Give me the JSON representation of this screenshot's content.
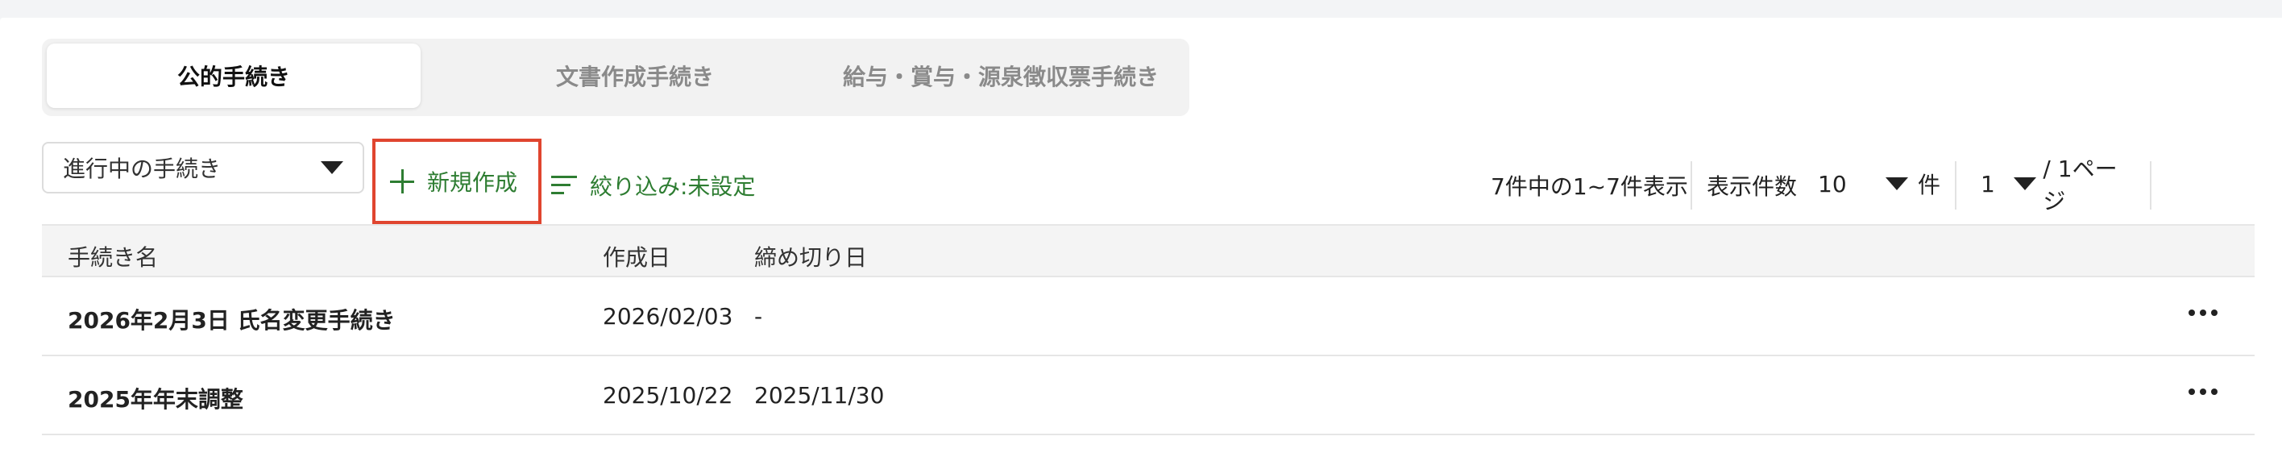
{
  "tabs": [
    "公的手続き",
    "文書作成手続き",
    "給与・賞与・源泉徴収票手続き"
  ],
  "toolbar": {
    "status_select": "進行中の手続き",
    "new_button": "新規作成",
    "filter": "絞り込み:未設定",
    "count_text": "7件中の1~7件表示",
    "per_page_label": "表示件数",
    "per_page_value": "10",
    "per_page_unit": "件",
    "page_value": "1",
    "page_unit": "/ 1ページ"
  },
  "table": {
    "headers": [
      "手続き名",
      "作成日",
      "締め切り日"
    ],
    "rows": [
      {
        "name": "2026年2月3日 氏名変更手続き",
        "created": "2026/02/03",
        "deadline": "-"
      },
      {
        "name": "2025年年末調整",
        "created": "2025/10/22",
        "deadline": "2025/11/30"
      }
    ]
  },
  "colors": {
    "accent_green": "#2e7d32",
    "highlight_red": "#e0452f"
  },
  "icons": [
    "plus-icon",
    "filter-icon",
    "caret-down-icon",
    "more-icon"
  ]
}
